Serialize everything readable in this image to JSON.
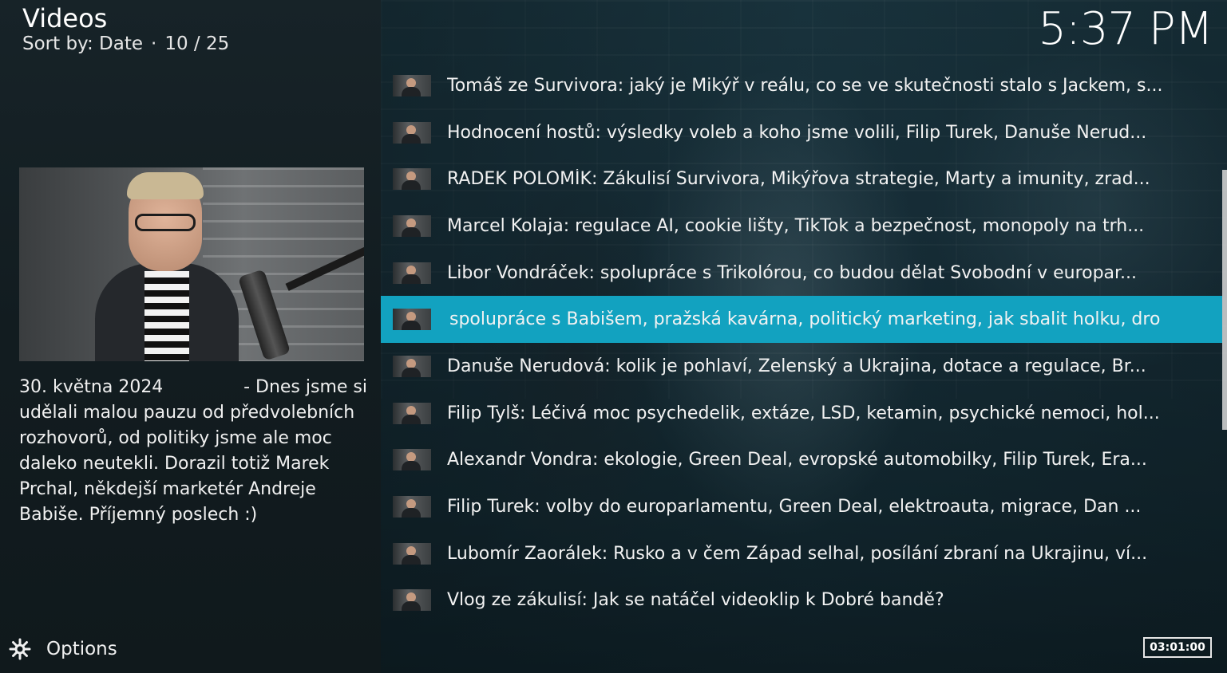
{
  "header": {
    "title": "Videos",
    "sort_label": "Sort by: Date",
    "separator": "·",
    "position": "10 / 25"
  },
  "clock": "5:37 PM",
  "plot": {
    "date": "30. května 2024",
    "first_fragment": "- Dnes jsme si",
    "body": "udělali malou pauzu od předvolebních rozhovorů, od politiky jsme ale moc daleko neutekli. Dorazil totiž Marek Prchal, někdejší marketér Andreje Babiše. Příjemný poslech :)"
  },
  "options": {
    "label": "Options",
    "icon": "gear-arrows-icon"
  },
  "list": {
    "selected_index": 5,
    "items": [
      {
        "title": "Tomáš ze Survivora: jaký je Mikýř v reálu, co se ve skutečnosti stalo s Jackem, s..."
      },
      {
        "title": "Hodnocení hostů: výsledky voleb a koho jsme volili, Filip Turek, Danuše Nerud..."
      },
      {
        "title": "RADEK POLOMÍK: Zákulisí Survivora, Mikýřova strategie, Marty a imunity, zrad..."
      },
      {
        "title": "Marcel Kolaja: regulace AI, cookie lišty, TikTok a bezpečnost, monopoly na trh..."
      },
      {
        "title": "Libor Vondráček: spolupráce s Trikolórou, co budou dělat Svobodní v europar..."
      },
      {
        "title": "spolupráce s Babišem, pražská kavárna, politický marketing, jak sbalit holku, dro"
      },
      {
        "title": "Danuše Nerudová: kolik je pohlaví, Zelenský a Ukrajina, dotace a regulace, Br..."
      },
      {
        "title": "Filip Tylš: Léčivá moc psychedelik, extáze, LSD, ketamin, psychické nemoci, hol..."
      },
      {
        "title": "Alexandr Vondra: ekologie, Green Deal, evropské automobilky, Filip Turek, Era..."
      },
      {
        "title": "Filip Turek: volby do europarlamentu, Green Deal, elektroauta, migrace, Dan ..."
      },
      {
        "title": "Lubomír Zaorálek: Rusko a v čem Západ selhal, posílání zbraní na Ukrajinu, ví..."
      },
      {
        "title": "Vlog ze zákulisí: Jak se natáčel videoklip k Dobré bandě?"
      }
    ]
  },
  "duration": "03:01:00",
  "colors": {
    "selection": "#12a2c0",
    "panel": "#121c20"
  }
}
